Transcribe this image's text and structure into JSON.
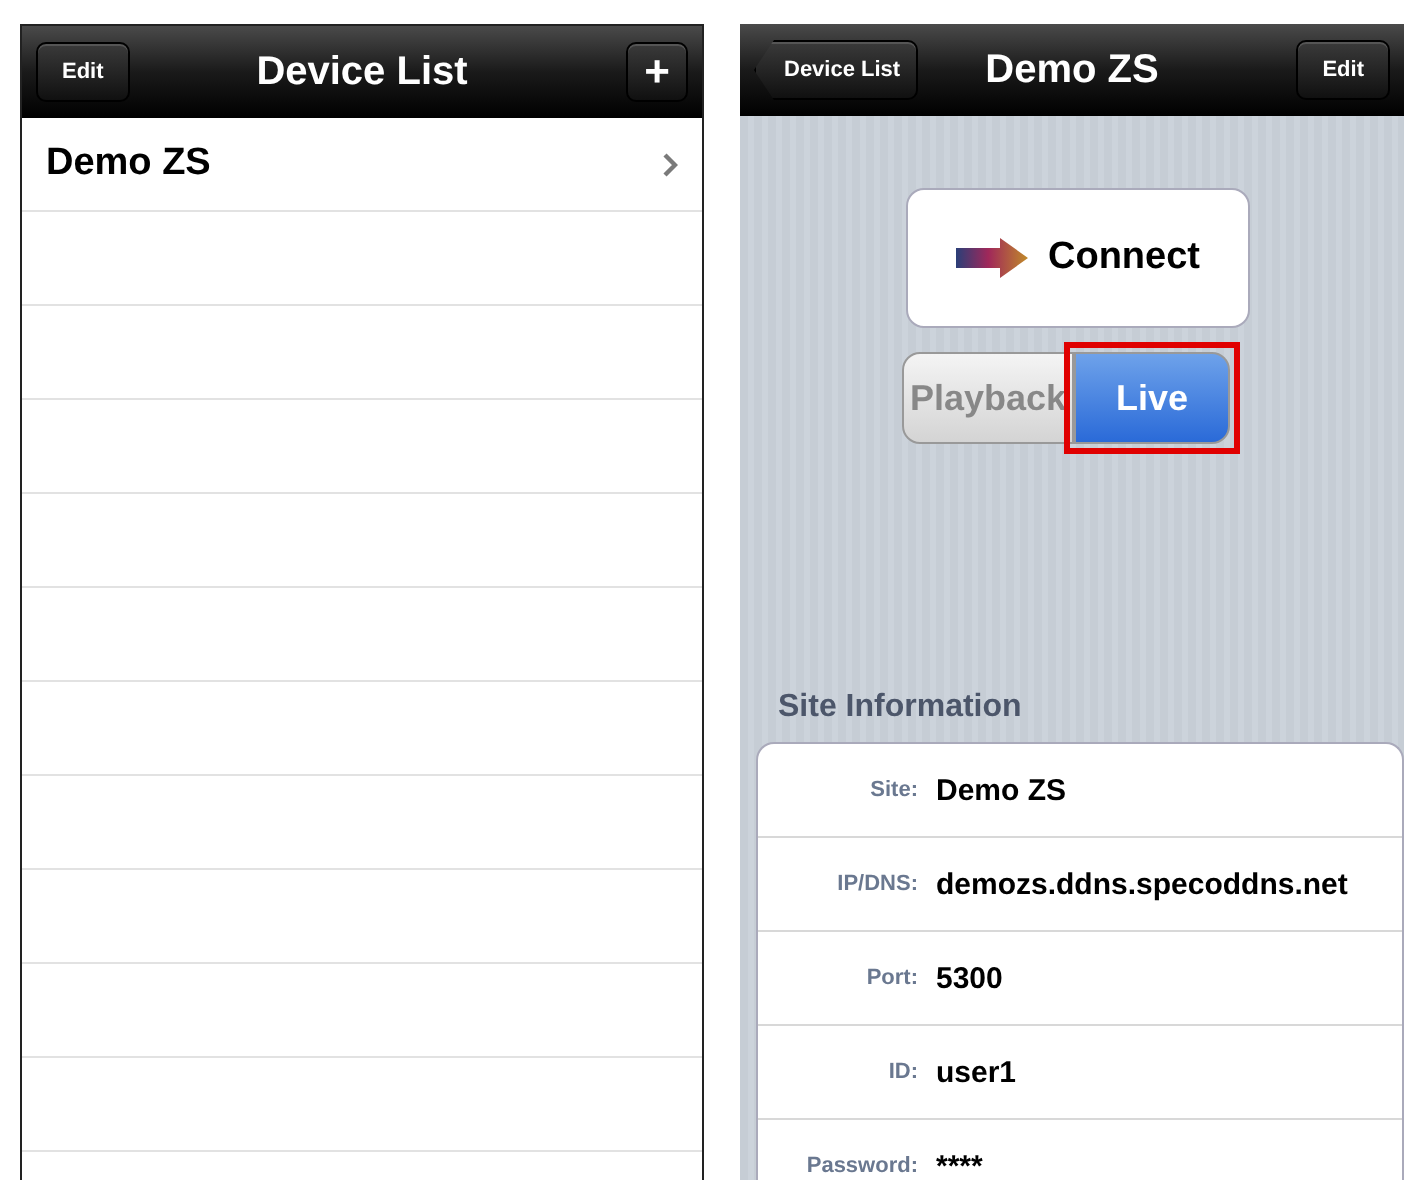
{
  "device_list": {
    "nav": {
      "left_button": "Edit",
      "title": "Device List",
      "right_button": "+"
    },
    "rows": [
      {
        "label": "Demo ZS",
        "chevron": true
      }
    ]
  },
  "device_detail": {
    "nav": {
      "back_button": "Device List",
      "title": "Demo ZS",
      "right_button": "Edit"
    },
    "connect_button": "Connect",
    "modes": [
      {
        "label": "Playback",
        "selected": false,
        "highlighted": false
      },
      {
        "label": "Live",
        "selected": true,
        "highlighted": true
      }
    ],
    "section_title": "Site Information",
    "fields": [
      {
        "label": "Site:",
        "value": "Demo ZS"
      },
      {
        "label": "IP/DNS:",
        "value": "demozs.ddns.specoddns.net"
      },
      {
        "label": "Port:",
        "value": "5300"
      },
      {
        "label": "ID:",
        "value": "user1"
      },
      {
        "label": "Password:",
        "value": "****"
      }
    ]
  }
}
